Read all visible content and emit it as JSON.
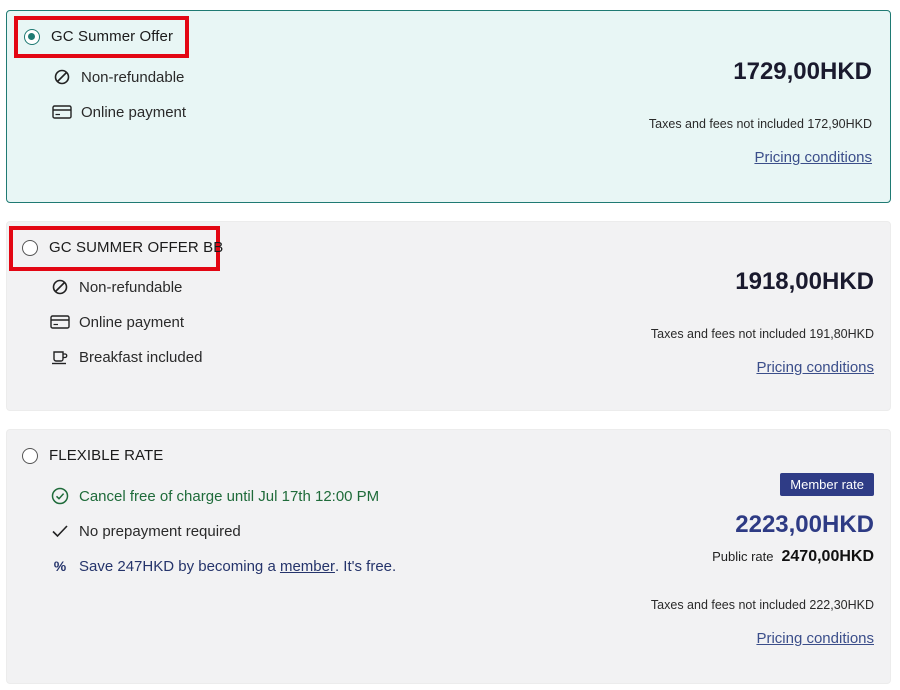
{
  "rates": [
    {
      "name": "GC Summer Offer",
      "selected": true,
      "features": [
        {
          "icon": "no-entry-icon",
          "text": "Non-refundable"
        },
        {
          "icon": "credit-card-icon",
          "text": "Online payment"
        }
      ],
      "price": "1729,00HKD",
      "taxes": "Taxes and fees not included 172,90HKD",
      "pricing_link": "Pricing conditions"
    },
    {
      "name": "GC SUMMER OFFER BB",
      "selected": false,
      "features": [
        {
          "icon": "no-entry-icon",
          "text": "Non-refundable"
        },
        {
          "icon": "credit-card-icon",
          "text": "Online payment"
        },
        {
          "icon": "coffee-cup-icon",
          "text": "Breakfast included"
        }
      ],
      "price": "1918,00HKD",
      "taxes": "Taxes and fees not included 191,80HKD",
      "pricing_link": "Pricing conditions"
    },
    {
      "name": "FLEXIBLE RATE",
      "selected": false,
      "features": [
        {
          "icon": "check-circle-icon",
          "text": "Cancel free of charge until Jul 17th 12:00 PM"
        },
        {
          "icon": "checkmark-icon",
          "text": "No prepayment required"
        },
        {
          "icon": "percent-icon",
          "text_before": "Save 247HKD by becoming a ",
          "link": "member",
          "text_after": ". It's free."
        }
      ],
      "badge": "Member rate",
      "price": "2223,00HKD",
      "public_rate_label": "Public rate",
      "public_rate_value": "2470,00HKD",
      "taxes": "Taxes and fees not included 222,30HKD",
      "pricing_link": "Pricing conditions"
    }
  ],
  "colors": {
    "selected_border": "#1f7a73",
    "selected_bg": "#e8f6f5",
    "card_bg": "#f2f2f3",
    "highlight": "#e30613",
    "member_blue": "#2e3b84"
  }
}
